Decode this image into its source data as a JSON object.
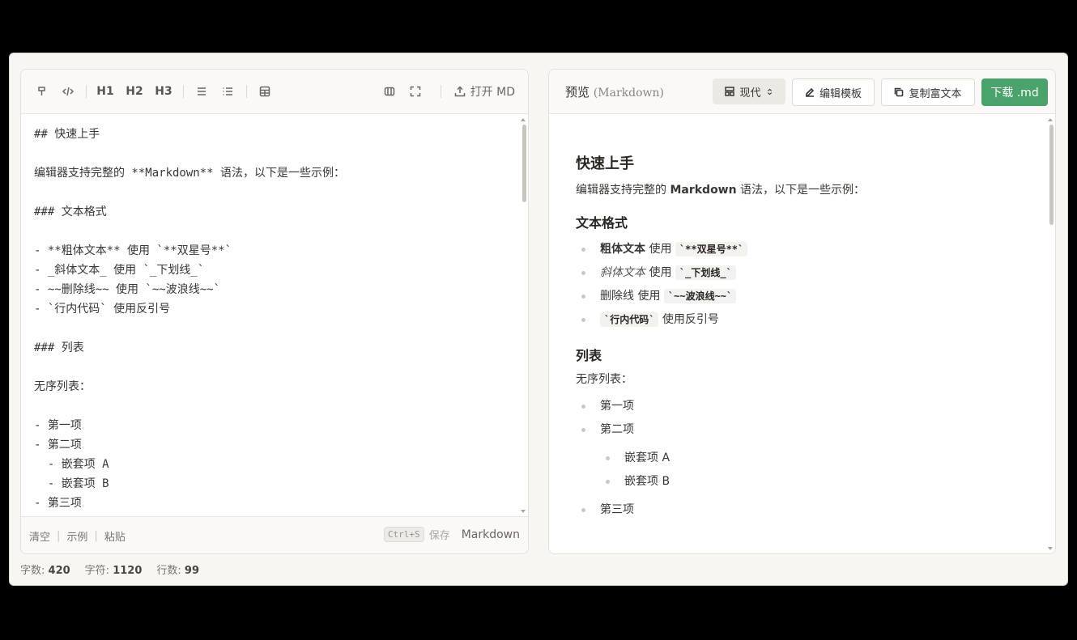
{
  "editor_toolbar": {
    "h1": "H1",
    "h2": "H2",
    "h3": "H3",
    "open_md": "打开 MD"
  },
  "editor": {
    "content": "## 快速上手\n\n编辑器支持完整的 **Markdown** 语法，以下是一些示例：\n\n### 文本格式\n\n- **粗体文本** 使用 `**双星号**`\n- _斜体文本_ 使用 `_下划线_`\n- ~~删除线~~ 使用 `~~波浪线~~`\n- `行内代码` 使用反引号\n\n### 列表\n\n无序列表：\n\n- 第一项\n- 第二项\n  - 嵌套项 A\n  - 嵌套项 B\n- 第三项"
  },
  "editor_footer": {
    "clear": "清空",
    "example": "示例",
    "paste": "粘贴",
    "shortcut": "Ctrl+S",
    "save": "保存",
    "mode": "Markdown"
  },
  "status": {
    "words_label": "字数:",
    "words": "420",
    "chars_label": "字符:",
    "chars": "1120",
    "lines_label": "行数:",
    "lines": "99"
  },
  "preview_toolbar": {
    "title": "预览",
    "subtitle": "(Markdown)",
    "theme": "现代",
    "edit_template": "编辑模板",
    "copy_rich": "复制富文本",
    "download": "下载 .md"
  },
  "preview": {
    "h2": "快速上手",
    "intro_pre": "编辑器支持完整的 ",
    "intro_bold": "Markdown",
    "intro_post": " 语法，以下是一些示例：",
    "h3_format": "文本格式",
    "fmt_bold": "粗体文本",
    "fmt_bold_use": " 使用 ",
    "fmt_bold_code": "`**双星号**`",
    "fmt_italic": "斜体文本",
    "fmt_italic_use": " 使用 ",
    "fmt_italic_code": "`_下划线_`",
    "fmt_strike": "删除线",
    "fmt_strike_use": " 使用 ",
    "fmt_strike_code": "`~~波浪线~~`",
    "fmt_code": "`行内代码`",
    "fmt_code_use": " 使用反引号",
    "h3_list": "列表",
    "unordered": "无序列表：",
    "item1": "第一项",
    "item2": "第二项",
    "nested_a": "嵌套项 A",
    "nested_b": "嵌套项 B",
    "item3": "第三项"
  }
}
